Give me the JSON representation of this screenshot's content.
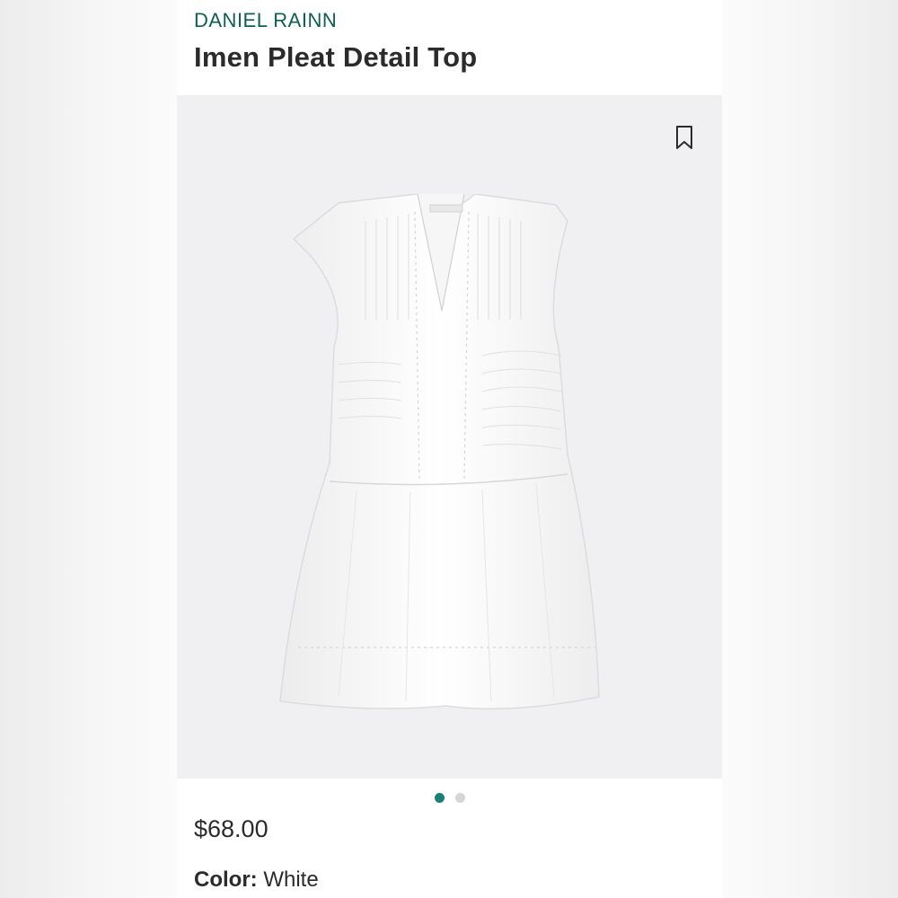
{
  "product": {
    "brand": "DANIEL RAINN",
    "title": "Imen Pleat Detail Top",
    "price": "$68.00",
    "color_label": "Color:",
    "color_value": "White"
  },
  "gallery": {
    "image_count": 2,
    "active_index": 0
  },
  "icons": {
    "bookmark": "bookmark-icon"
  },
  "colors": {
    "brand": "#0f5e54",
    "dot_active": "#1a7f76",
    "dot_inactive": "#d6d6d8",
    "image_bg": "#f0f0f2"
  }
}
